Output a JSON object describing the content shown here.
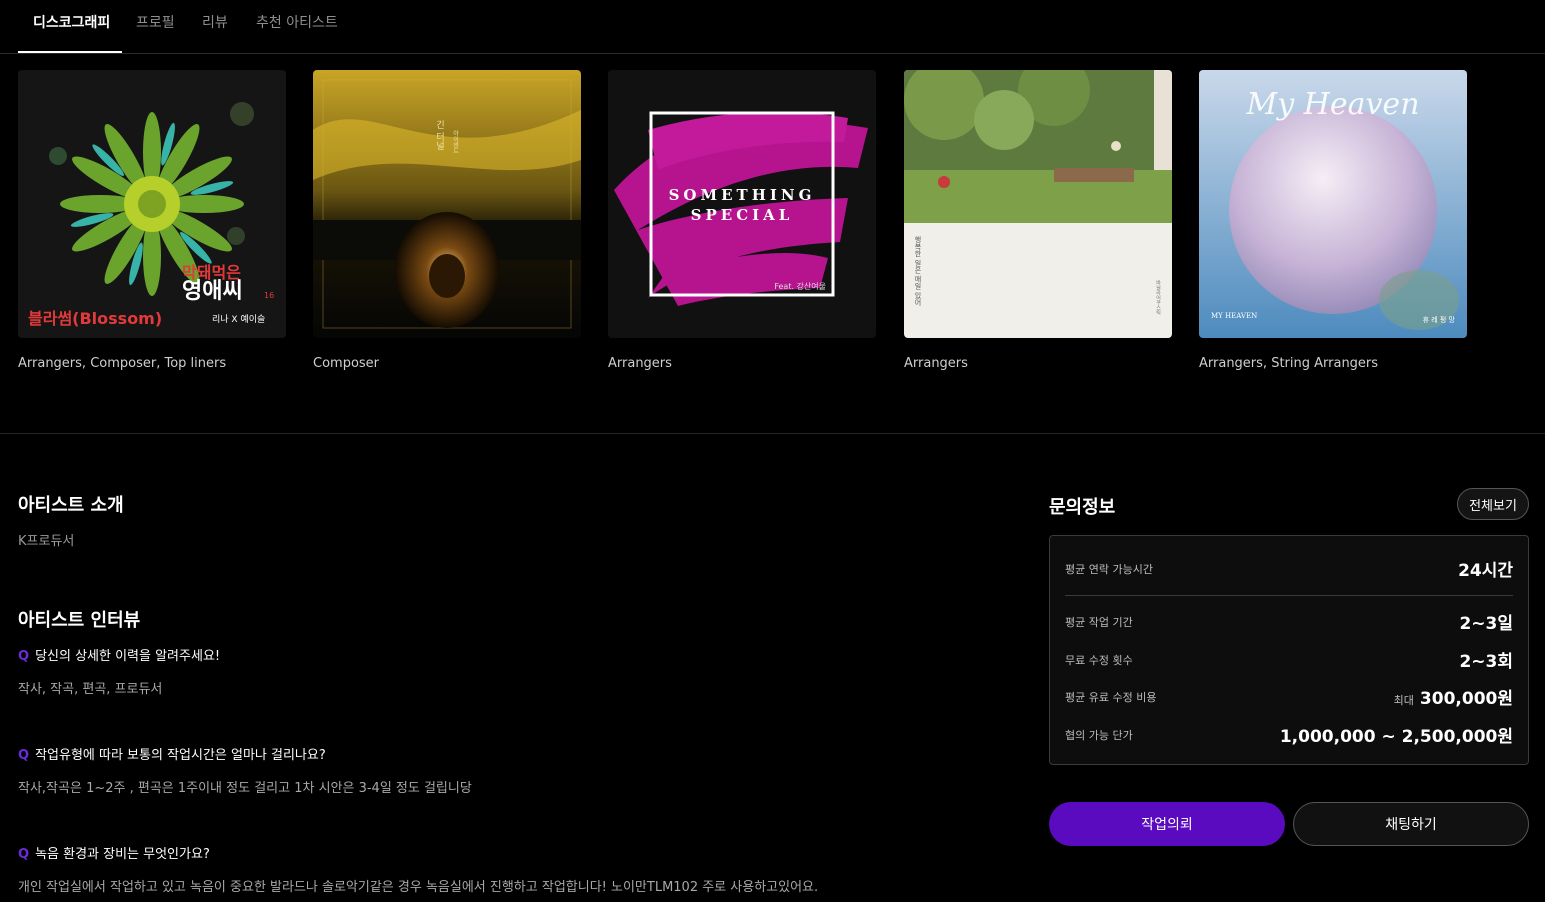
{
  "tabs": [
    {
      "label": "디스코그래피"
    },
    {
      "label": "프로필"
    },
    {
      "label": "리뷰"
    },
    {
      "label": "추천 아티스트"
    }
  ],
  "albums": [
    {
      "role": "Arrangers, Composer, Top liners",
      "cover_text_1": "블라썸(Blossom)",
      "cover_text_2": "막돼먹은",
      "cover_text_3": "영애씨",
      "cover_text_4": "리나 X 예이슬",
      "cover_text_5": "16"
    },
    {
      "role": "Composer",
      "cover_text_1": "긴 터널",
      "cover_text_2": "아이엔드"
    },
    {
      "role": "Arrangers",
      "cover_text_1": "SOMETHING",
      "cover_text_2": "SPECIAL",
      "cover_text_3": "Feat. 강산여울"
    },
    {
      "role": "Arrangers",
      "cover_text_1": "행복한 일은 매일 있어",
      "cover_text_2": "바닐라어쿠스틱"
    },
    {
      "role": "Arrangers, String Arrangers",
      "cover_text_1": "My Heaven",
      "cover_text_2": "MY HEAVEN",
      "cover_text_3": "휴 레 펑 망"
    }
  ],
  "intro": {
    "title": "아티스트 소개",
    "text": "K프로듀서"
  },
  "interview": {
    "title": "아티스트 인터뷰",
    "q_mark": "Q",
    "items": [
      {
        "q": "당신의 상세한 이력을 알려주세요!",
        "a": "작사, 작곡, 편곡, 프로듀서"
      },
      {
        "q": "작업유형에 따라 보통의 작업시간은 얼마나 걸리나요?",
        "a": "작사,작곡은 1~2주 , 편곡은 1주이내 정도 걸리고 1차 시안은 3-4일 정도 걸립니당"
      },
      {
        "q": "녹음 환경과 장비는 무엇인가요?",
        "a": "개인 작업실에서 작업하고 있고 녹음이 중요한 발라드나 솔로악기같은 경우 녹음실에서 진행하고 작업합니다! 노이만TLM102 주로 사용하고있어요."
      }
    ]
  },
  "contact": {
    "title": "문의정보",
    "view_all": "전체보기",
    "rows": [
      {
        "label": "평균 연락 가능시간",
        "value": "24시간",
        "prefix": ""
      },
      {
        "label": "평균 작업 기간",
        "value": "2~3일",
        "prefix": ""
      },
      {
        "label": "무료 수정 횟수",
        "value": "2~3회",
        "prefix": ""
      },
      {
        "label": "평균 유료 수정 비용",
        "value": "300,000원",
        "prefix": "최대"
      },
      {
        "label": "협의 가능 단가",
        "value": "1,000,000 ~ 2,500,000원",
        "prefix": ""
      }
    ]
  },
  "buttons": {
    "request": "작업의뢰",
    "chat": "채팅하기"
  },
  "colors": {
    "accent": "#5a0bbf",
    "q_mark": "#6b2bd9"
  }
}
